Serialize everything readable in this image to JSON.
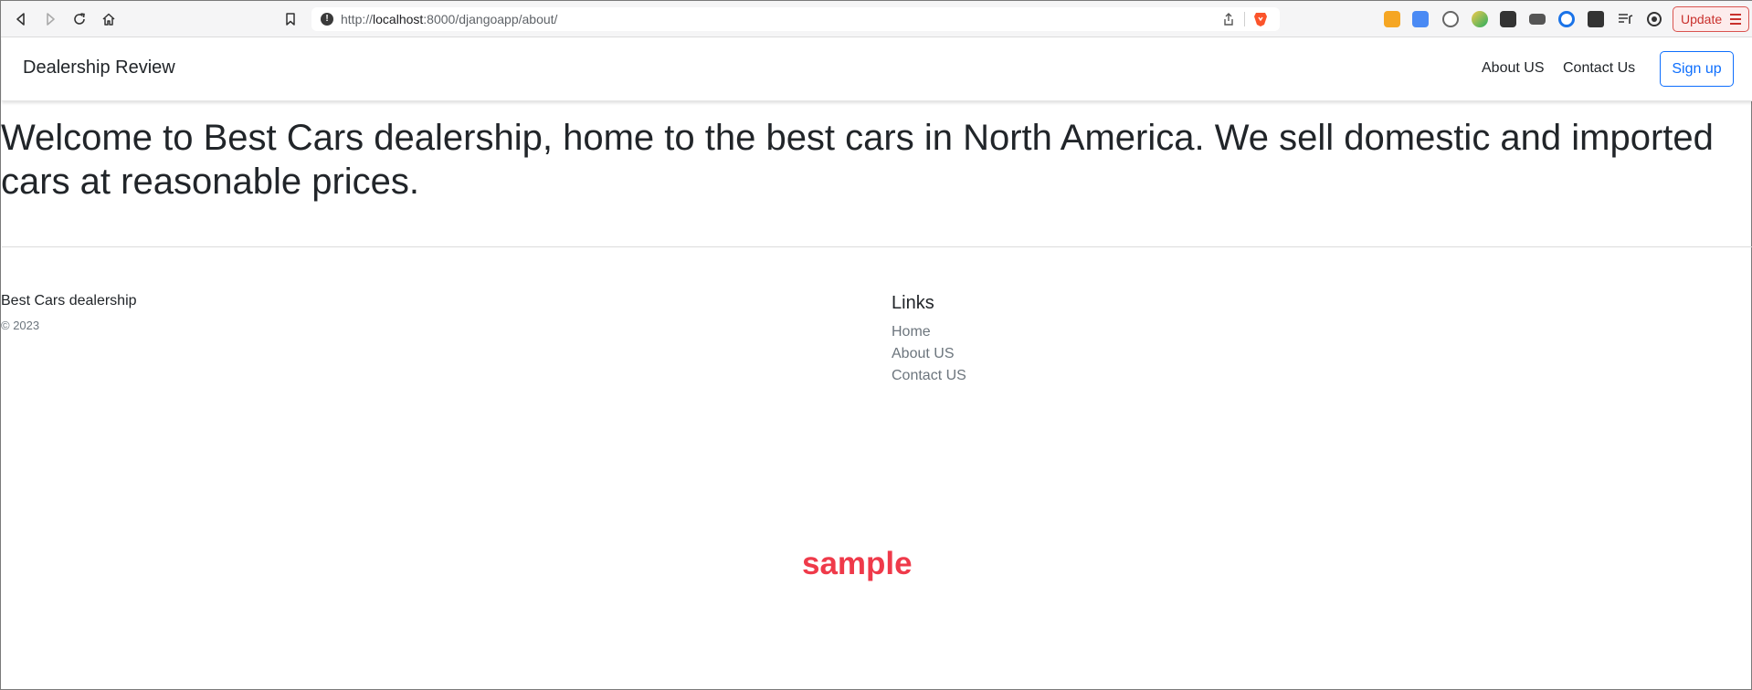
{
  "browser": {
    "url_prefix": "http://",
    "url_host": "localhost",
    "url_rest": ":8000/djangoapp/about/",
    "update_label": "Update",
    "icons": [
      "back-icon",
      "forward-icon",
      "reload-icon",
      "home-icon",
      "bookmark-icon",
      "info-icon",
      "share-icon",
      "brave-icon"
    ],
    "extensions": [
      "calculator-extension-icon",
      "translate-extension-icon",
      "dashlane-extension-icon",
      "rocket-extension-icon",
      "cube-extension-icon",
      "reader-extension-icon",
      "password-extension-icon",
      "puzzle-extensions-icon",
      "playlist-icon",
      "wallet-icon"
    ]
  },
  "navbar": {
    "brand": "Dealership Review",
    "links": [
      "About US",
      "Contact Us"
    ],
    "signup": "Sign up"
  },
  "main": {
    "welcome": "Welcome to Best Cars dealership, home to the best cars in North America. We sell domestic and imported cars at reasonable prices."
  },
  "footer": {
    "brand": "Best Cars dealership",
    "copyright": "© 2023",
    "links_title": "Links",
    "links": [
      "Home",
      "About US",
      "Contact US"
    ]
  },
  "watermark": "sample",
  "colors": {
    "primary": "#0d6efd",
    "update": "#c9302c",
    "watermark": "#ef3a4a"
  }
}
